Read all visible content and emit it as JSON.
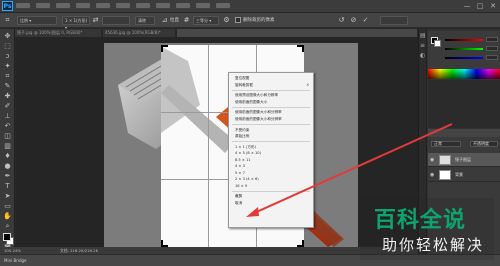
{
  "app": {
    "logo": "Ps"
  },
  "menubar": {
    "window_controls": [
      "—",
      "□",
      "✕"
    ]
  },
  "options_bar": {
    "ratio_select": "比例 ▾",
    "width_field": "1 × 1(方形) ▾",
    "height_field": "",
    "clear_button": "清除",
    "straighten_label": "拉直",
    "view_select": "三等分 ▾",
    "delete_pixels_label": "删除裁剪的像素"
  },
  "tabs": [
    {
      "label": "锤子.jpg @ 100%(图层 0, RGB/8)*",
      "active": false
    },
    {
      "label": "45636.jpg @ 100%(RGB/8)*",
      "active": false
    },
    {
      "label": "",
      "active": true
    }
  ],
  "context_menu": {
    "items": [
      {
        "label": "复位视图",
        "shortcut": ""
      },
      {
        "label": "旋转裁剪框",
        "shortcut": "X"
      },
      {
        "sep": true
      },
      {
        "label": "使用预设图像大小和分辨率",
        "shortcut": ""
      },
      {
        "label": "使用前面的图像大小",
        "shortcut": ""
      },
      {
        "sep": true
      },
      {
        "label": "使用前面的图像大小和分辨率",
        "shortcut": ""
      },
      {
        "label": "使用前面的图像大小和分辨率",
        "shortcut": ""
      },
      {
        "sep": true
      },
      {
        "label": "不受约束",
        "shortcut": ""
      },
      {
        "label": "原始比例",
        "shortcut": ""
      },
      {
        "sep": true
      },
      {
        "label": "1 × 1 (方形)",
        "shortcut": ""
      },
      {
        "label": "4 × 5 (8 × 10)",
        "shortcut": ""
      },
      {
        "label": "8.5 × 11",
        "shortcut": ""
      },
      {
        "label": "4 × 3",
        "shortcut": ""
      },
      {
        "label": "5 × 7",
        "shortcut": ""
      },
      {
        "label": "2 × 3 (4 × 6)",
        "shortcut": ""
      },
      {
        "label": "16 × 9",
        "shortcut": ""
      },
      {
        "sep": true
      },
      {
        "label": "裁剪",
        "shortcut": "",
        "highlight": true
      },
      {
        "label": "取消",
        "shortcut": ""
      }
    ]
  },
  "layers_panel": {
    "blend_mode": "正常",
    "opacity": "不透明度",
    "layers": [
      {
        "name": "锤子图层",
        "selected": true
      },
      {
        "name": "背景",
        "selected": false
      }
    ]
  },
  "status": {
    "zoom": "100.24%",
    "doc": "文档: 216.2K/216.2K"
  },
  "bottombar": {
    "tab_label": "Mini Bridge"
  },
  "watermark": {
    "main": "百科全说",
    "sub": "助你轻松解决"
  },
  "colors": {
    "accent": "#31a8ff",
    "watermark_green": "#0ea46f",
    "arrow_red": "#e23b3b"
  }
}
